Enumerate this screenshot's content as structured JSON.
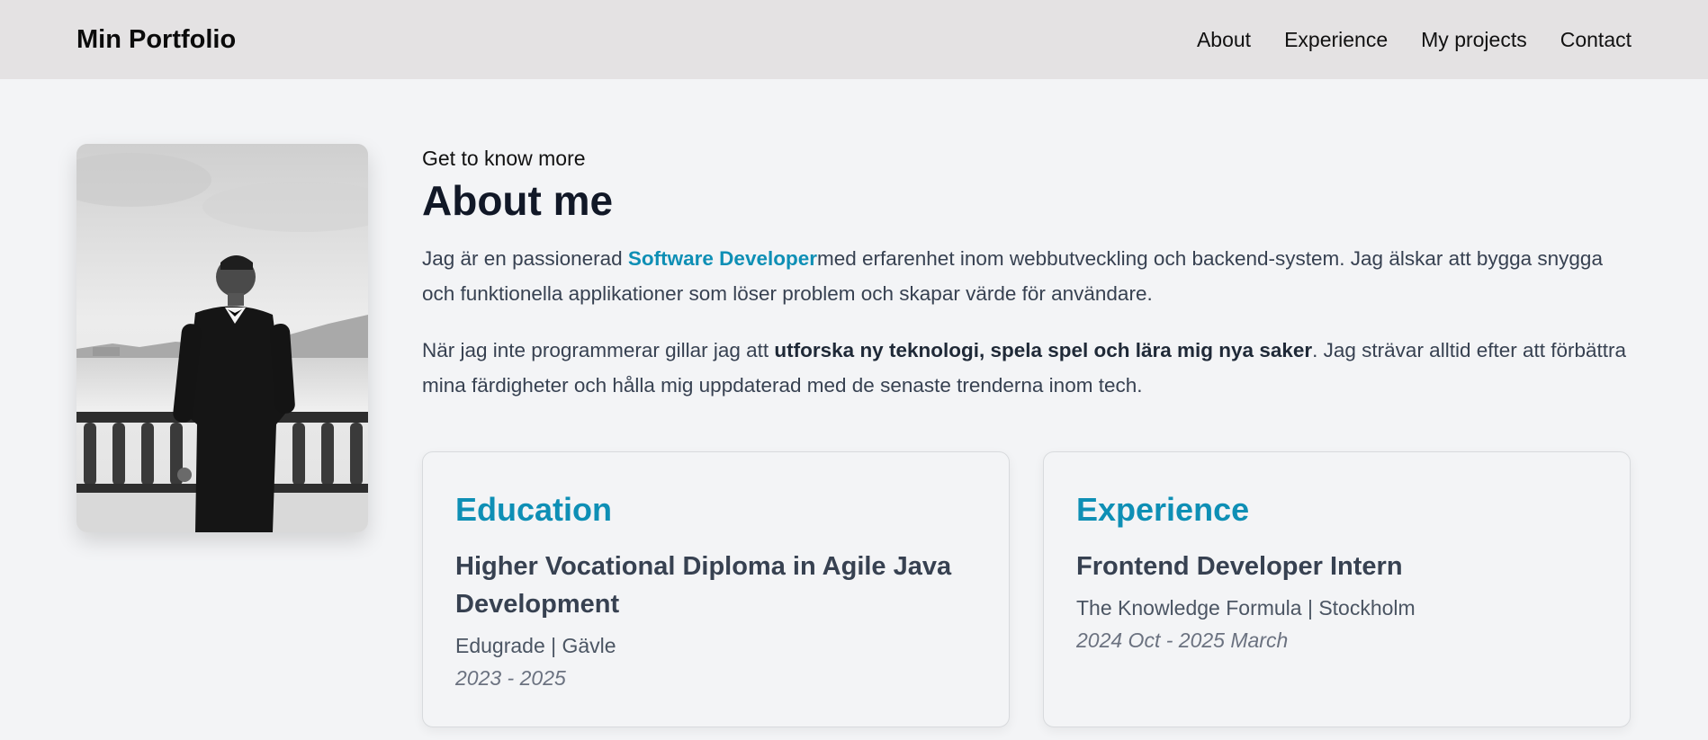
{
  "navbar": {
    "brand": "Min Portfolio",
    "links": [
      "About",
      "Experience",
      "My projects",
      "Contact"
    ]
  },
  "about": {
    "eyebrow": "Get to know more",
    "heading": "About me",
    "para1": {
      "before": "Jag är en passionerad ",
      "highlight": "Software Developer",
      "after": "med erfarenhet inom webbutveckling och backend-system. Jag älskar att bygga snygga och funktionella applikationer som löser problem och skapar värde för användare."
    },
    "para2": {
      "before": "När jag inte programmerar gillar jag att ",
      "bold": "utforska ny teknologi, spela spel och lära mig nya saker",
      "after": ". Jag strävar alltid efter att förbättra mina färdigheter och hålla mig uppdaterad med de senaste trenderna inom tech."
    },
    "photo_alt": "Man in black tuxedo standing by a waterfront balustrade"
  },
  "cards": [
    {
      "title": "Education",
      "role": "Higher Vocational Diploma in Agile Java Development",
      "org": "Edugrade | Gävle",
      "date": "2023 - 2025"
    },
    {
      "title": "Experience",
      "role": "Frontend Developer Intern",
      "org": "The Knowledge Formula | Stockholm",
      "date": "2024 Oct - 2025 March"
    }
  ],
  "colors": {
    "accent": "#0e8fb5",
    "navbar_bg": "#e4e2e3",
    "page_bg": "#f3f4f6"
  }
}
